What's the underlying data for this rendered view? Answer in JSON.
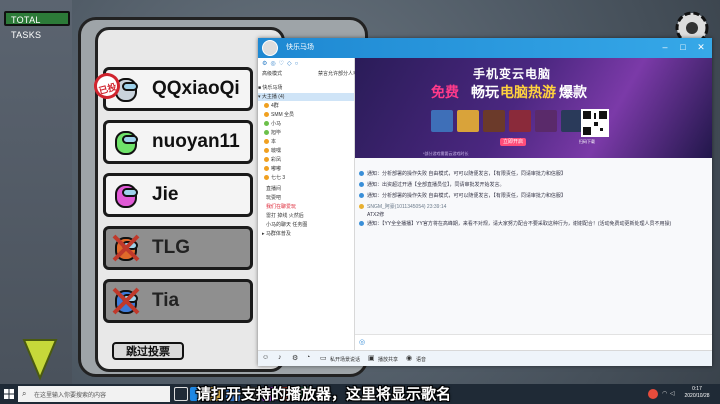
{
  "game": {
    "task_bar_label": "TOTAL TASKS",
    "voted_badge": "已投",
    "skip_label": "跳过投票",
    "players": [
      {
        "name": "QQxiaoQi",
        "color": "#c9d3dc",
        "dead": false
      },
      {
        "name": "nuoyan11",
        "color": "#6fe36a",
        "dead": false
      },
      {
        "name": "Jie",
        "color": "#e05ad6",
        "dead": false
      },
      {
        "name": "TLG",
        "color": "#e06a2a",
        "dead": true
      },
      {
        "name": "Tia",
        "color": "#3d7ad8",
        "dead": true
      }
    ]
  },
  "qq": {
    "title": "快乐马场",
    "sidebar": {
      "header_left": "高级模式",
      "header_right": "禁言允许部分人可以发言",
      "group": "■ 快乐马场",
      "subgroup": "▾ 大主播 (4)",
      "members": [
        "4群",
        "SMM 全员",
        "小马",
        "旭毕",
        "本",
        "啵嘿",
        "彩凤",
        "嘟嘟",
        "七七 3"
      ],
      "rows": [
        "直播间",
        "玩耍吧",
        "我们在聊爱玩",
        "雷打 掉线 火然后",
        "小马的聊天 任务图",
        "▸ 马群体普及"
      ]
    },
    "banner": {
      "line1": "手机变云电脑",
      "free": "免费",
      "play": "畅玩",
      "hot": "电脑热游",
      "burst": "爆款",
      "cta": "立即开启",
      "qr_label": "扫码下载",
      "fine_print": "*部分游戏需要云游戏时长"
    },
    "messages": [
      "通知：分析部署的操作失败 自由模式，可可以随便发言，【有限责任，同请审批力和信服】",
      "通知：出资超过开通【全部直播员位】，同请审批发开始发言。",
      "通知：分析部署的操作失败 自由模式，可可以随便发言，【有限责任，同请审批力和信服】",
      "SNGM_阿豪(1011345054) 23:39:14",
      "ATX2修",
      "通知：【YY全全播播】YY官方将在高峰期，来看不对规，请大家努力配合不要采取这种行为，谢谢配合！(活动免费动更新处理人员不用操)"
    ],
    "toolbar": {
      "screen": "私开场景说话",
      "share": "播放共享",
      "voice": "语音"
    }
  },
  "subtitle": "请打开支持的播放器，这里将显示歌名",
  "taskbar": {
    "search_placeholder": "在这里输入你要搜索的内容",
    "time": "0:17",
    "date": "2020/10/28"
  }
}
